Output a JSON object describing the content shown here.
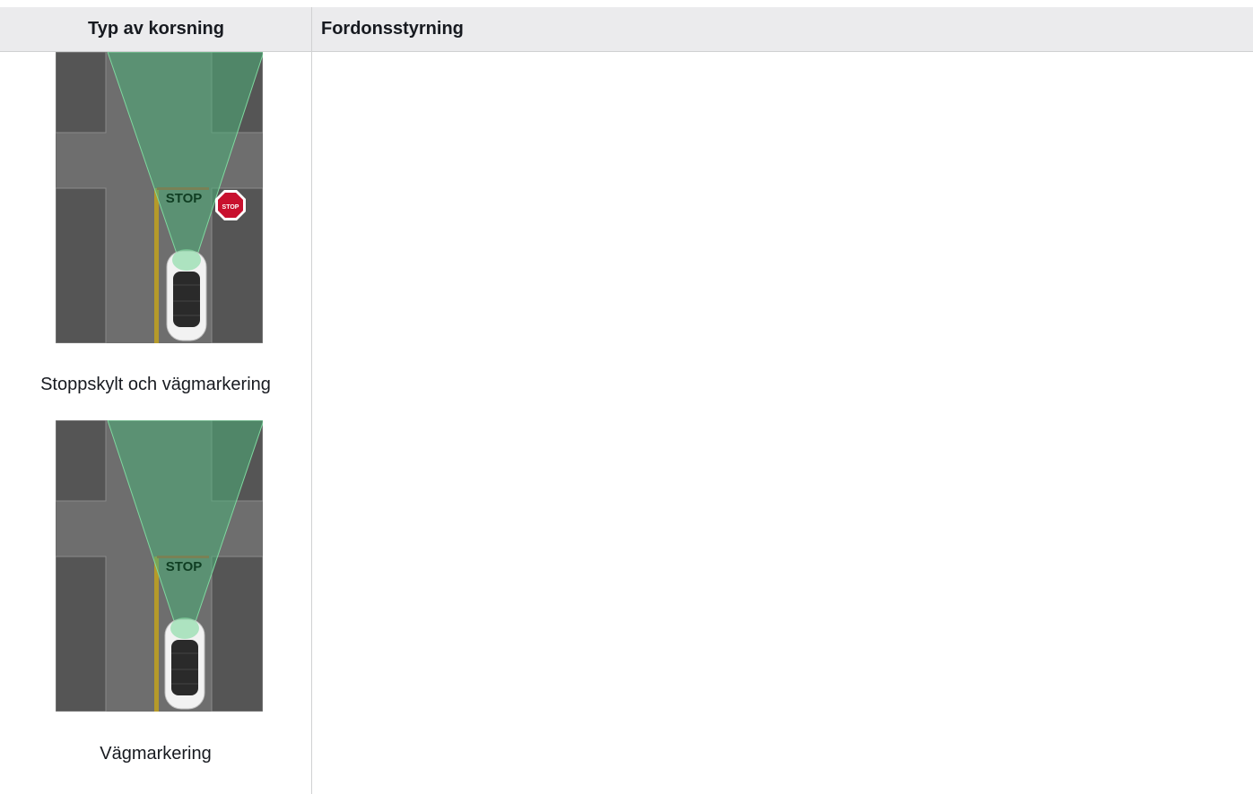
{
  "table": {
    "headers": [
      "Typ av korsning",
      "Fordonsstyrning"
    ],
    "rows": [
      {
        "caption": "Stoppskylt och vägmarkering",
        "road_text": "STOP",
        "sign_text": "STOP"
      },
      {
        "caption": "Vägmarkering",
        "road_text": "STOP"
      }
    ]
  },
  "colors": {
    "header_bg": "#ebebed",
    "road": "#6e6e6e",
    "block": "#555555",
    "field_of_view": "#4caf78",
    "stop_line": "#b04a2a",
    "center_line": "#b59a2a",
    "stop_sign": "#c8102e"
  }
}
